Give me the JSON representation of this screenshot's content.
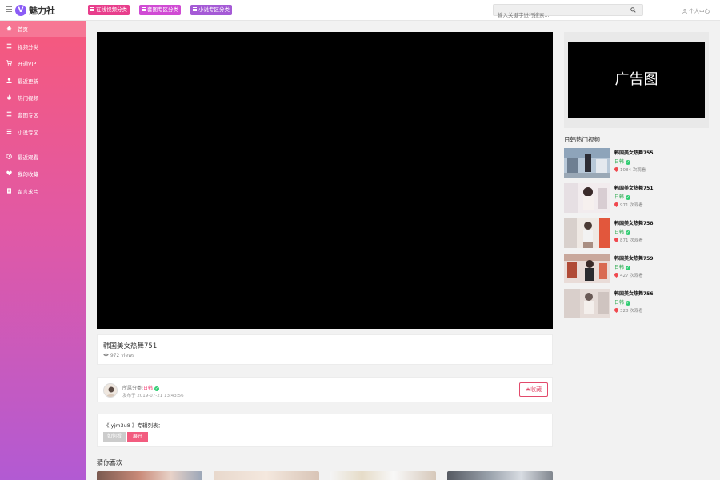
{
  "header": {
    "logo_badge": "V",
    "logo_text": "魅力社",
    "tabs": [
      {
        "label": "在线视频分类",
        "color": "#e83e8c"
      },
      {
        "label": "套图专区分类",
        "color": "#d04bd4"
      },
      {
        "label": "小说专区分类",
        "color": "#a55ad6"
      }
    ],
    "search_placeholder": "输入关键字进行搜索...",
    "user_center_label": "个人中心"
  },
  "sidebar": {
    "items": [
      {
        "label": "首页",
        "icon": "home-icon"
      },
      {
        "label": "视频分类",
        "icon": "list-icon"
      },
      {
        "label": "开通VIP",
        "icon": "cart-icon"
      },
      {
        "label": "最近更新",
        "icon": "user-icon"
      },
      {
        "label": "热门视频",
        "icon": "fire-icon"
      },
      {
        "label": "套图专区",
        "icon": "list-icon"
      },
      {
        "label": "小说专区",
        "icon": "list-icon"
      },
      {
        "label": "最近观看",
        "icon": "history-icon"
      },
      {
        "label": "我的收藏",
        "icon": "heart-icon"
      },
      {
        "label": "留言求片",
        "icon": "document-icon"
      }
    ],
    "gradient_colors": [
      "#f6597c",
      "#e159a5",
      "#b25ad3"
    ]
  },
  "video": {
    "title": "韩国美女热舞751",
    "views": "972 views",
    "category_prefix": "所属分类:",
    "category": "日韩",
    "published": "发布于 2019-07-21 13:43:56",
    "favorite_label": "收藏"
  },
  "album": {
    "title": "《 yjm3u8 》专辑列表：",
    "current_label": "如何看",
    "open_label": "展开"
  },
  "guess": {
    "title": "猜你喜欢"
  },
  "right": {
    "ad_text": "广告图",
    "hot_title": "日韩热门视频",
    "hot_items": [
      {
        "name": "韩国美女热舞755",
        "category": "日韩",
        "views": "1084 次观看"
      },
      {
        "name": "韩国美女热舞751",
        "category": "日韩",
        "views": "971 次观看"
      },
      {
        "name": "韩国美女热舞758",
        "category": "日韩",
        "views": "871 次观看"
      },
      {
        "name": "韩国美女热舞759",
        "category": "日韩",
        "views": "427 次观看"
      },
      {
        "name": "韩国美女热舞756",
        "category": "日韩",
        "views": "328 次观看"
      }
    ]
  },
  "colors": {
    "accent": "#f25c7f",
    "verify": "#2ecc71",
    "player_bg": "#000000"
  }
}
